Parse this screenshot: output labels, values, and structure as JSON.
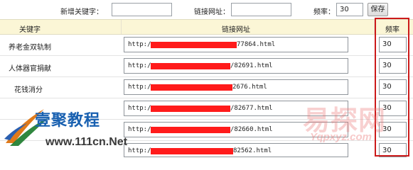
{
  "toolbar": {
    "new_keyword_label": "新增关键字：",
    "new_keyword_value": "",
    "link_label": "链接网址：",
    "link_value": "",
    "freq_label": "频率：",
    "freq_value": "30",
    "save_label": "保存"
  },
  "table": {
    "headers": {
      "keyword": "关键字",
      "url": "链接网址",
      "freq": "频率"
    },
    "rows": [
      {
        "keyword": "养老金双轨制",
        "url_prefix": "http:/",
        "url_tail": "77864.html",
        "freq": "30"
      },
      {
        "keyword": "人体器官捐献",
        "url_prefix": "http:/",
        "url_tail": "/82691.html",
        "freq": "30"
      },
      {
        "keyword": "花钱消分",
        "url_prefix": "http:/",
        "url_tail": "2676.html",
        "freq": "30"
      },
      {
        "keyword": "",
        "url_prefix": "http:/",
        "url_tail": "/82677.html",
        "freq": "30"
      },
      {
        "keyword": "",
        "url_prefix": "http:/",
        "url_tail": "/82660.html",
        "freq": "30"
      },
      {
        "keyword": "",
        "url_prefix": "http:/",
        "url_tail": "82562.html",
        "freq": "30"
      }
    ]
  },
  "watermarks": {
    "brand_title": "壹聚教程",
    "brand_site": "www.111cn.Net",
    "yjb_text": "易探网",
    "yjb_site": "Yqpxyz.com"
  },
  "colors": {
    "header_bg": "#fbf6d6",
    "redaction": "#ff1b1b",
    "highlight_border": "#cc1a1a",
    "brand_blue": "#1860b0"
  }
}
